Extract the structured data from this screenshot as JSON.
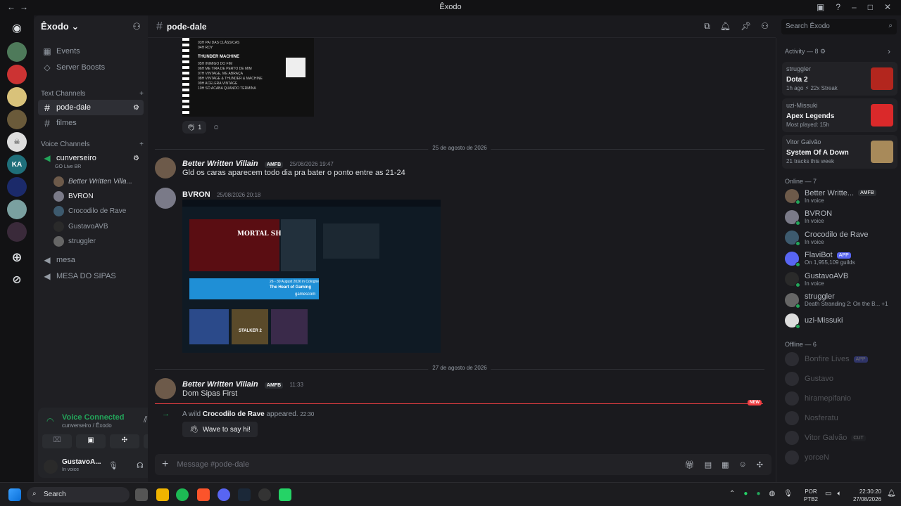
{
  "window": {
    "title": "Êxodo"
  },
  "server": {
    "name": "Êxodo"
  },
  "sidebar": {
    "events": "Events",
    "boosts": "Server Boosts",
    "text_category": "Text Channels",
    "text_channels": [
      "pode-dale",
      "filmes"
    ],
    "voice_category": "Voice Channels",
    "voice_channel": "cunverseiro",
    "voice_sub": "GO Live BR",
    "voice_users": [
      "Better Written Villa...",
      "BVRON",
      "Crocodilo de Rave",
      "GustavoAVB",
      "struggler"
    ],
    "other_channels": [
      "mesa",
      "MESA DO SIPAS"
    ]
  },
  "voice_panel": {
    "status": "Voice Connected",
    "location": "cunverseiro / Êxodo"
  },
  "user_panel": {
    "name": "GustavoA...",
    "sub": "In voice"
  },
  "channel": {
    "name": "pode-dale"
  },
  "search": {
    "placeholder": "Search Êxodo"
  },
  "image1": {
    "heading": "THUNDER MACHINE",
    "lines": [
      "03H PAI DAS CLÁSSICAS",
      "04H ROY",
      "05H INIMIGO DO FIM",
      "06H ME TIRA DE PERTO DE MIM",
      "07H VINTAGE, ME ABRAÇA",
      "08H VINTAGE & THUNDER & MACHINE",
      "09H ACELERA VINTAGE",
      "10H SÓ ACABA QUANDO TERMINA"
    ]
  },
  "reactions": {
    "count": "1"
  },
  "dates": {
    "d1": "25 de agosto de 2026",
    "d2": "27 de agosto de 2026"
  },
  "messages": [
    {
      "author": "Better Written Villain",
      "badge": "AMFB",
      "time": "25/08/2026 19:47",
      "text": "Gld os caras aparecem todo dia pra bater o ponto entre as 21-24"
    },
    {
      "author": "BVRON",
      "time": "25/08/2026 20:18"
    },
    {
      "author": "Better Written Villain",
      "badge": "AMFB",
      "time": "11:33",
      "text": "Dom Sipas First"
    }
  ],
  "screenshot2": {
    "game1": "MORTAL SHELL II",
    "banner_title": "The Heart of Gaming",
    "banner_brand": "gamescom",
    "banner_date": "26 - 30 August 2026 in Cologne",
    "game2": "STALKER 2"
  },
  "join": {
    "prefix": "A wild",
    "name": "Crocodilo de Rave",
    "suffix": "appeared.",
    "time": "22:30",
    "wave": "Wave to say hi!"
  },
  "new_label": "NEW",
  "composer": {
    "placeholder": "Message #pode-dale"
  },
  "activity": {
    "title": "Activity — 8",
    "cards": [
      {
        "who": "struggler",
        "game": "Dota 2",
        "meta": "1h ago  ⚡ 22x Streak"
      },
      {
        "who": "uzi-Missuki",
        "game": "Apex Legends",
        "meta": "Most played: 15h"
      },
      {
        "who": "Vitor Galvão",
        "game": "System Of A Down",
        "meta": "21 tracks this week"
      }
    ]
  },
  "online": {
    "label": "Online — 7",
    "members": [
      {
        "name": "Better Writte...",
        "sub": "In voice",
        "tag": "AMFB",
        "color": "#6d5a4a"
      },
      {
        "name": "BVRON",
        "sub": "In voice",
        "color": "#7a7a88"
      },
      {
        "name": "Crocodilo de Rave",
        "sub": "In voice",
        "color": "#3d5a6e"
      },
      {
        "name": "FlaviBot",
        "sub": "On 1,955,109 guilds",
        "tag": "APP",
        "color": "#5865f2"
      },
      {
        "name": "GustavoAVB",
        "sub": "In voice",
        "color": "#2a2a2a"
      },
      {
        "name": "struggler",
        "sub": "Death Stranding 2: On the B...  +1",
        "color": "#666"
      },
      {
        "name": "uzi-Missuki",
        "sub": "",
        "color": "#ddd"
      }
    ]
  },
  "offline": {
    "label": "Offline — 6",
    "members": [
      {
        "name": "Bonfire Lives",
        "tag": "APP"
      },
      {
        "name": "Gustavo"
      },
      {
        "name": "hiramepifanio"
      },
      {
        "name": "Nosferatu"
      },
      {
        "name": "Vitor Galvão",
        "tag": "CUT"
      },
      {
        "name": "yorceN"
      }
    ]
  },
  "taskbar": {
    "search": "Search",
    "lang": "POR",
    "layout": "PTB2",
    "time": "22:30:20",
    "date": "27/08/2026"
  }
}
